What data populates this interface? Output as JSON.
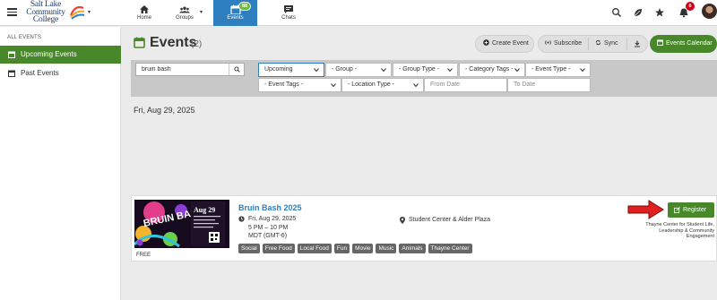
{
  "topbar": {
    "logo_text": [
      "Salt Lake",
      "Community",
      "College"
    ],
    "nav": [
      {
        "label": "Home",
        "icon": "home-icon"
      },
      {
        "label": "Groups",
        "icon": "groups-icon"
      },
      {
        "label": "Events",
        "icon": "calendar-icon",
        "badge": "88"
      },
      {
        "label": "Chats",
        "icon": "chat-icon"
      }
    ],
    "right_icons": [
      "search-icon",
      "leaf-icon",
      "star-icon",
      "bell-icon"
    ],
    "bell_badge": "6"
  },
  "sidebar": {
    "heading": "ALL EVENTS",
    "items": [
      {
        "label": "Upcoming Events",
        "active": true
      },
      {
        "label": "Past Events",
        "active": false
      }
    ]
  },
  "page": {
    "title": "Events",
    "count": "(2)",
    "buttons": {
      "create": "Create Event",
      "subscribe": "Subscribe",
      "sync": "Sync",
      "calendar": "Events Calendar"
    }
  },
  "filters": {
    "search_value": "bruin bash",
    "timeframe": "Upcoming",
    "group": "- Group -",
    "group_type": "- Group Type -",
    "category_tags": "- Category Tags -",
    "event_type": "- Event Type -",
    "event_tags": "- Event Tags -",
    "location_type": "- Location Type -",
    "from_date": "From Date",
    "to_date": "To Date"
  },
  "date_heading": "Fri, Aug 29, 2025",
  "event": {
    "title": "Bruin Bash 2025",
    "date_line1": "Fri, Aug 29, 2025",
    "date_line2": "5 PM – 10 PM",
    "date_line3": "MDT (GMT-6)",
    "location": "Student Center & Alder Plaza",
    "price": "FREE",
    "tags": [
      "Social",
      "Free Food",
      "Local Food",
      "Fun",
      "Movie",
      "Music",
      "Animals",
      "Thayne Center"
    ],
    "register_label": "Register",
    "host": "Thayne Center for Student Life, Leadership & Community Engagement",
    "flyer_text": {
      "title": "BRUIN BASH",
      "date": "Aug 29"
    }
  },
  "colors": {
    "brand_green": "#48882b",
    "brand_blue": "#2e7fbf",
    "arrow_red": "#e02020"
  }
}
